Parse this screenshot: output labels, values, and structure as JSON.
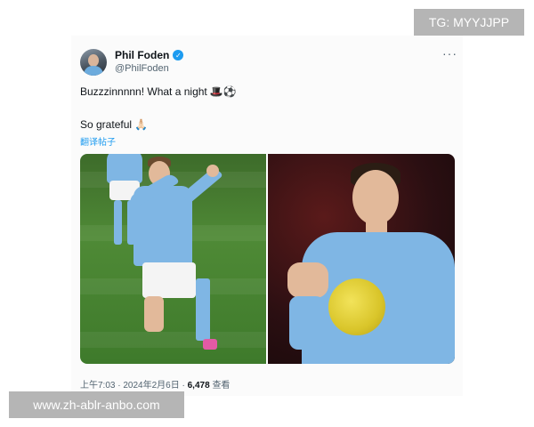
{
  "author": {
    "name": "Phil Foden",
    "handle": "@PhilFoden",
    "verified": true,
    "verified_color": "#1d9bf0"
  },
  "tweet": {
    "line1": "Buzzzinnnnn! What a night",
    "line1_emojis": "🎩⚽",
    "line2": "So grateful",
    "line2_emoji": "🙏🏻",
    "translate_label": "翻译帖子"
  },
  "menu_icon": "···",
  "meta": {
    "time": "上午7:03",
    "date": "2024年2月6日",
    "views_count": "6,478",
    "views_label": "查看"
  },
  "overlays": {
    "tg_label": "TG: MYYJJPP",
    "site_label": "www.zh-ablr-anbo.com"
  },
  "photos": [
    {
      "icon": "celebration-photo"
    },
    {
      "icon": "applause-photo"
    }
  ]
}
